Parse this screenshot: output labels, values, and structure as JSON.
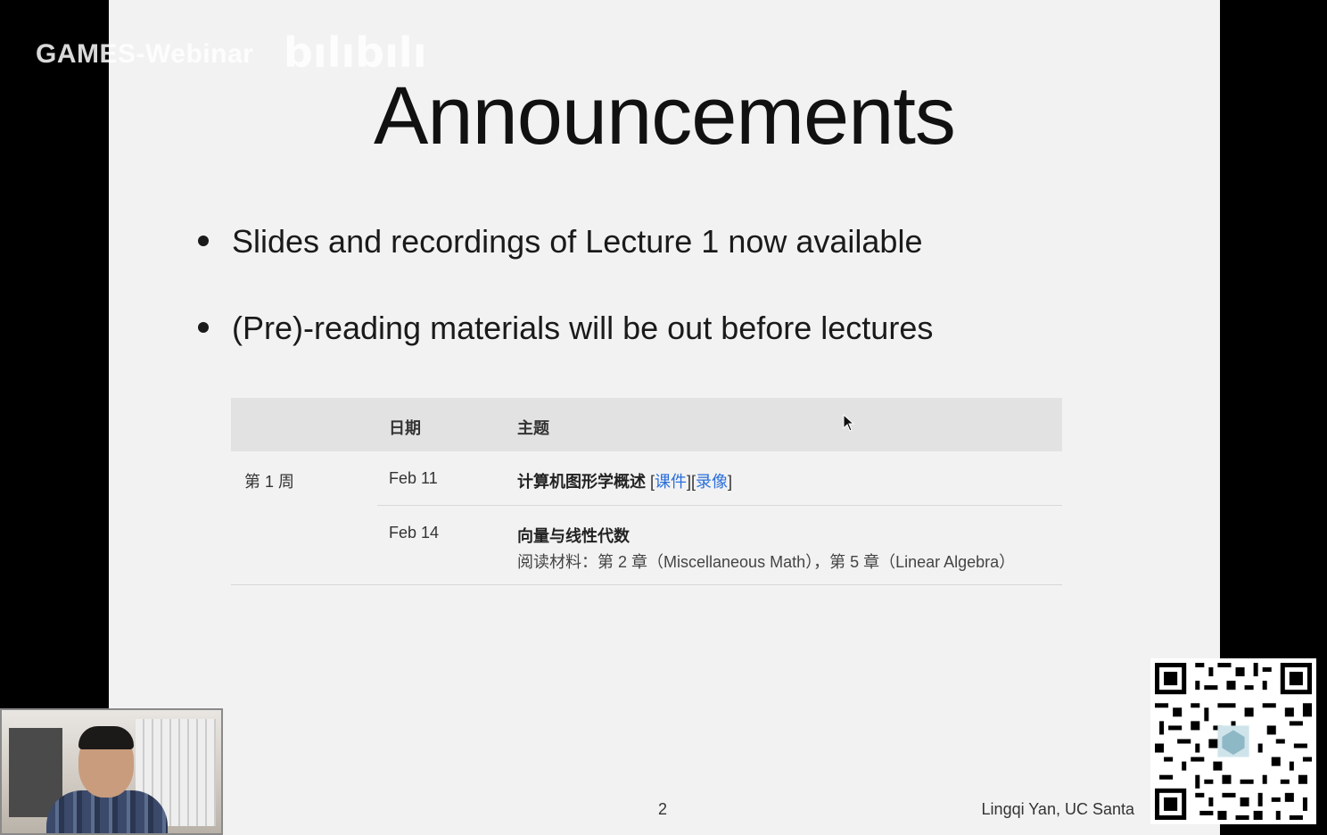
{
  "watermark": {
    "text": "GAMES-Webinar",
    "logo": "bilibili"
  },
  "slide": {
    "title": "Announcements",
    "bullets": [
      "Slides and recordings of Lecture 1 now available",
      "(Pre)-reading materials will be out before lectures"
    ],
    "table": {
      "headers": [
        "",
        "日期",
        "主题"
      ],
      "week": "第 1 周",
      "rows": [
        {
          "date": "Feb 11",
          "topic": "计算机图形学概述",
          "links": [
            "课件",
            "录像"
          ]
        },
        {
          "date": "Feb 14",
          "topic": "向量与线性代数",
          "reading": "阅读材料：第 2 章（Miscellaneous Math），第 5 章（Linear Algebra）"
        }
      ]
    },
    "page_number": "2",
    "author": "Lingqi Yan, UC Santa"
  },
  "colors": {
    "link": "#2a6fdb",
    "header_bg": "#e2e2e2",
    "slide_bg": "#f2f2f2"
  }
}
